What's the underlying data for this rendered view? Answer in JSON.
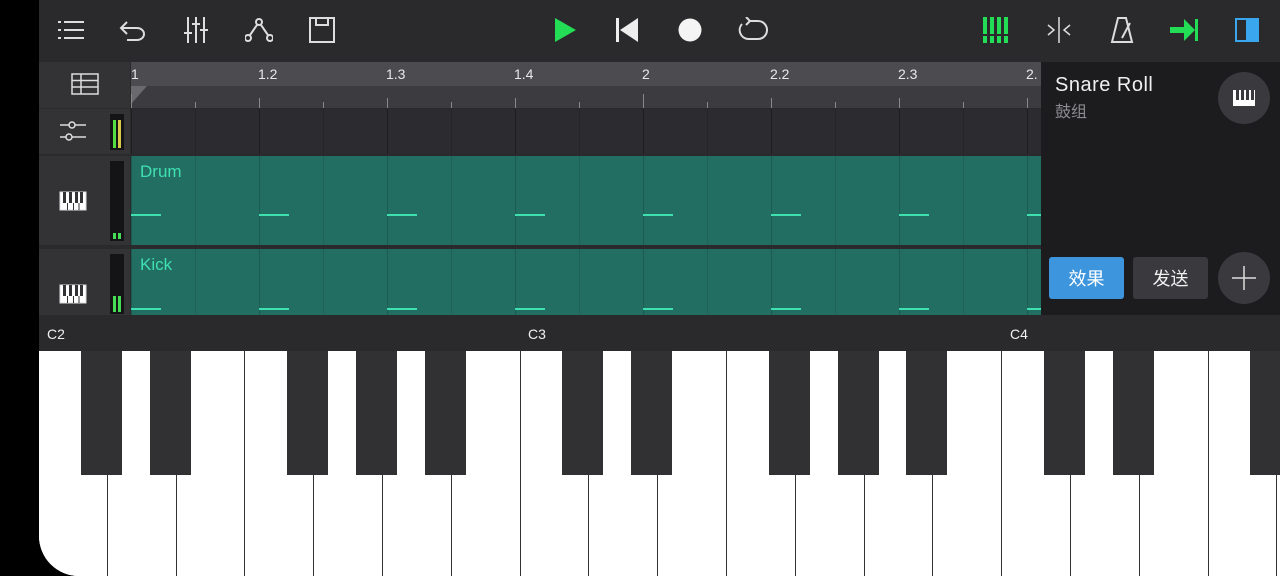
{
  "toolbar": {
    "left_icons": [
      "menu-icon",
      "undo-icon",
      "mixer-icon",
      "automation-icon",
      "save-icon"
    ],
    "center_icons": [
      "play-icon",
      "rewind-icon",
      "record-icon",
      "loop-icon"
    ],
    "right_icons": [
      "keyboard-toggle-icon",
      "split-icon",
      "metronome-icon",
      "follow-icon",
      "panel-toggle-icon"
    ],
    "colors": {
      "accent_green": "#22dd55",
      "accent_blue": "#3d95dd"
    }
  },
  "ruler": {
    "labels": [
      "1",
      "1.2",
      "1.3",
      "1.4",
      "2",
      "2.2",
      "2.3",
      "2."
    ]
  },
  "tracks": [
    {
      "name": "Drum",
      "icon": "piano-icon"
    },
    {
      "name": "Kick",
      "icon": "piano-icon"
    }
  ],
  "track_color": "#236e63",
  "master_track": {
    "icon": "routing-icon"
  },
  "sidebar": {
    "top_icon": "track-list-icon"
  },
  "right_panel": {
    "instrument_name": "Snare Roll",
    "instrument_group": "鼓组",
    "effects_label": "效果",
    "send_label": "发送"
  },
  "keyboard": {
    "octave_labels": [
      "C2",
      "C3",
      "C4"
    ]
  }
}
